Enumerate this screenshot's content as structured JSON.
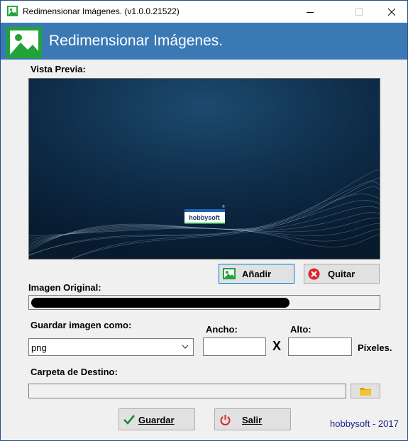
{
  "window": {
    "title": "Redimensionar Imágenes. (v1.0.0.21522)",
    "controls": {
      "minimize": "–",
      "maximize": "□",
      "close": "✕"
    }
  },
  "header": {
    "title": "Redimensionar Imágenes."
  },
  "preview": {
    "label": "Vista Previa:",
    "logo_text": "hobbysoft",
    "logo_mark": "®"
  },
  "actions": {
    "add_label": "Añadir",
    "remove_label": "Quitar"
  },
  "original": {
    "label": "Imagen Original:"
  },
  "save_as": {
    "label": "Guardar imagen como:",
    "selected": "png"
  },
  "size": {
    "width_label": "Ancho:",
    "height_label": "Alto:",
    "x_label": "X",
    "units_label": "Píxeles.",
    "width_value": "",
    "height_value": ""
  },
  "destination": {
    "label": "Carpeta de Destino:",
    "value": ""
  },
  "buttons": {
    "save_label": "Guardar",
    "exit_label": "Salir"
  },
  "footer": {
    "credit": "hobbysoft - 2017"
  },
  "colors": {
    "header_bg": "#3b79b5",
    "accent_border": "#0078d7",
    "footer_text": "#1a1a8c"
  },
  "icons": {
    "app": "image-icon",
    "add": "image-icon",
    "remove": "remove-icon",
    "folder": "folder-icon",
    "save": "checkmark-icon",
    "exit": "power-icon",
    "dropdown": "chevron-down-icon"
  }
}
